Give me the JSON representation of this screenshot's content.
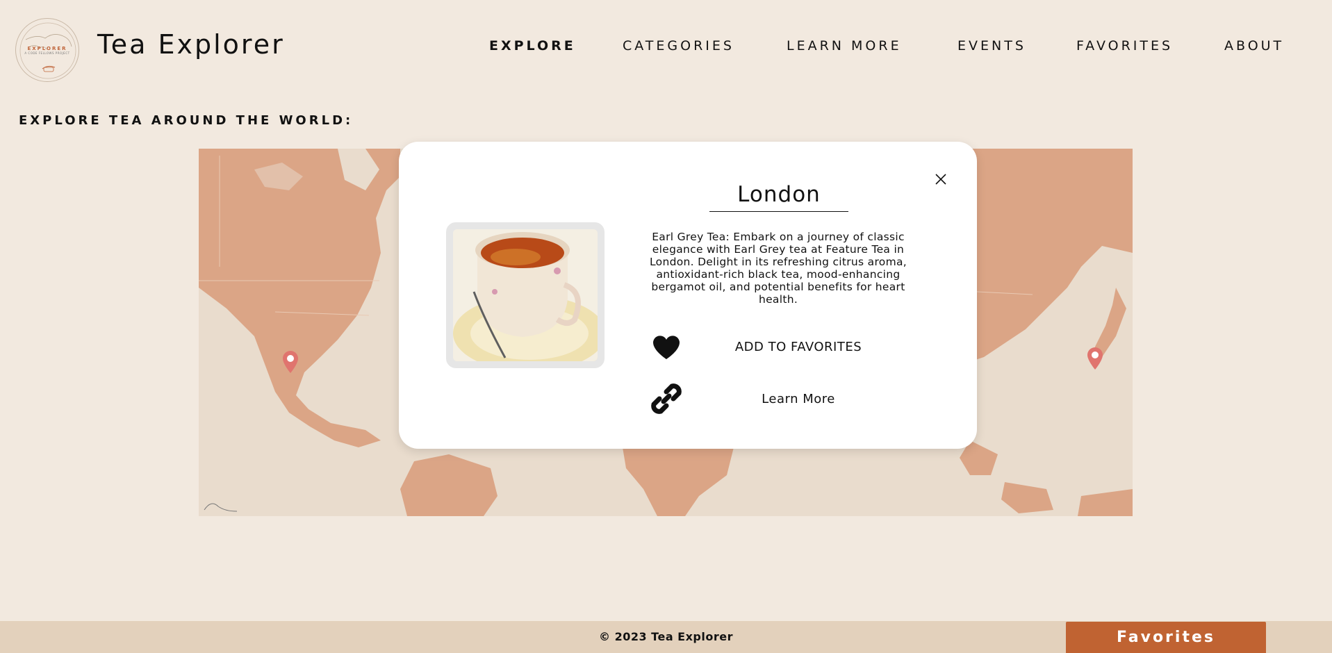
{
  "brand": {
    "name": "Tea Explorer",
    "logo_text": "EXPLORER",
    "logo_subtext": "A CODE FELLOWS PROJECT"
  },
  "nav": {
    "items": [
      {
        "label": "EXPLORE",
        "active": true
      },
      {
        "label": "CATEGORIES",
        "active": false
      },
      {
        "label": "LEARN MORE",
        "active": false
      },
      {
        "label": "EVENTS",
        "active": false
      },
      {
        "label": "FAVORITES",
        "active": false
      },
      {
        "label": "ABOUT",
        "active": false
      }
    ]
  },
  "section_title": "EXPLORE TEA AROUND THE WORLD:",
  "map": {
    "pins": [
      "Los Angeles",
      "Tokyo"
    ],
    "land_color": "#dba586",
    "water_color": "#e9dccd",
    "pin_color": "#e0746e"
  },
  "modal": {
    "city": "London",
    "description": "Earl Grey Tea: Embark on a journey of classic elegance with Earl Grey tea at Feature Tea in London. Delight in its refreshing citrus aroma, antioxidant-rich black tea, mood-enhancing bergamot oil, and potential benefits for heart health.",
    "add_to_favorites": "ADD TO FAVORITES",
    "learn_more": "Learn More",
    "image_icon": "teacup-photo",
    "close_icon": "close-icon"
  },
  "footer": {
    "copyright": "© 2023 Tea Explorer",
    "favorites_button": "Favorites",
    "accent_color": "#c06332"
  }
}
